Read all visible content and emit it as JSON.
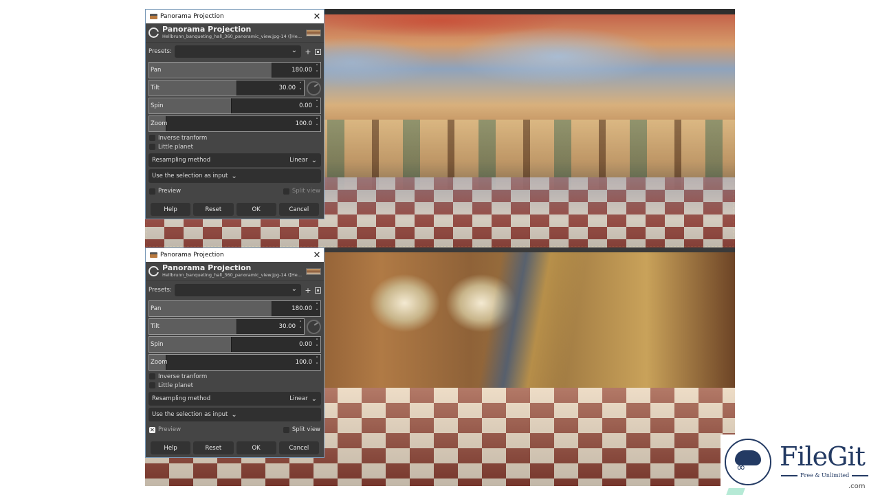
{
  "dialogs": [
    {
      "window_title": "Panorama Projection",
      "header_title": "Panorama Projection",
      "header_subtitle": "Hellbrunn_banqueting_hall_360_panoramic_view.jpg-14 ([He...",
      "presets_label": "Presets:",
      "presets_value": "",
      "sliders": {
        "pan": {
          "label": "Pan",
          "value": "180.00",
          "fraction": 0.72
        },
        "tilt": {
          "label": "Tilt",
          "value": "30.00",
          "fraction": 0.57
        },
        "spin": {
          "label": "Spin",
          "value": "0.00",
          "fraction": 0.48
        },
        "zoom": {
          "label": "Zoom",
          "value": "100.0",
          "fraction": 0.1
        }
      },
      "inverse_transform": {
        "label": "Inverse tranform",
        "checked": false
      },
      "little_planet": {
        "label": "Little planet",
        "checked": false
      },
      "resampling": {
        "label": "Resampling method",
        "value": "Linear"
      },
      "input_mode": {
        "value": "Use the selection as input"
      },
      "preview": {
        "label": "Preview",
        "checked": false,
        "mark": ""
      },
      "split_view": {
        "label": "Split view",
        "checked": false,
        "enabled": false
      },
      "buttons": {
        "help": "Help",
        "reset": "Reset",
        "ok": "OK",
        "cancel": "Cancel"
      }
    },
    {
      "window_title": "Panorama Projection",
      "header_title": "Panorama Projection",
      "header_subtitle": "Hellbrunn_banqueting_hall_360_panoramic_view.jpg-14 ([He...",
      "presets_label": "Presets:",
      "presets_value": "",
      "sliders": {
        "pan": {
          "label": "Pan",
          "value": "180.00",
          "fraction": 0.72
        },
        "tilt": {
          "label": "Tilt",
          "value": "30.00",
          "fraction": 0.57
        },
        "spin": {
          "label": "Spin",
          "value": "0.00",
          "fraction": 0.48
        },
        "zoom": {
          "label": "Zoom",
          "value": "100.0",
          "fraction": 0.1
        }
      },
      "inverse_transform": {
        "label": "Inverse tranform",
        "checked": false
      },
      "little_planet": {
        "label": "Little planet",
        "checked": false
      },
      "resampling": {
        "label": "Resampling method",
        "value": "Linear"
      },
      "input_mode": {
        "value": "Use the selection as input"
      },
      "preview": {
        "label": "Preview",
        "checked": true,
        "mark": "✕"
      },
      "split_view": {
        "label": "Split view",
        "checked": false,
        "enabled": true
      },
      "buttons": {
        "help": "Help",
        "reset": "Reset",
        "ok": "OK",
        "cancel": "Cancel"
      }
    }
  ],
  "icons": {
    "close": "✕",
    "chevron_down": "⌄",
    "add": "+",
    "spin_arrows": "˄˅"
  },
  "watermark": {
    "brand": "FileGit",
    "tagline": "Free & Unlimited",
    "tld": ".com"
  },
  "colors": {
    "dialog_bg": "#454545",
    "watermark": "#233a63",
    "selection_marching_ants": "#d6c544"
  }
}
